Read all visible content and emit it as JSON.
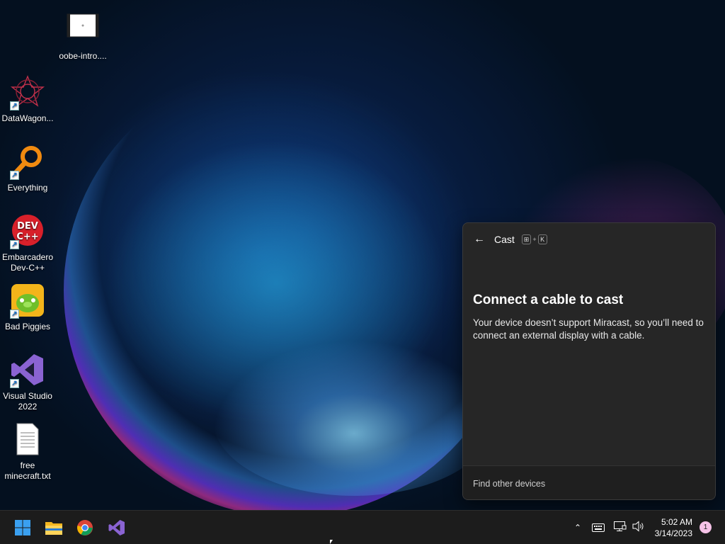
{
  "desktop": {
    "icons": [
      {
        "label": "oobe-intro....",
        "icon": "video-file-icon"
      },
      {
        "label": "DataWagon...",
        "icon": "datawagon-icon"
      },
      {
        "label": "Everything",
        "icon": "everything-search-icon"
      },
      {
        "label": "Embarcadero Dev-C++",
        "icon": "devcpp-icon"
      },
      {
        "label": "Bad Piggies",
        "icon": "bad-piggies-icon"
      },
      {
        "label": "Visual Studio 2022",
        "icon": "visual-studio-icon"
      },
      {
        "label": "free minecraft.txt",
        "icon": "text-file-icon"
      }
    ]
  },
  "cast_panel": {
    "title": "Cast",
    "shortcut_key1": "⊞",
    "shortcut_plus": "+",
    "shortcut_key2": "K",
    "heading": "Connect a cable to cast",
    "description": "Your device doesn’t support Miracast, so you’ll need to connect an external display with a cable.",
    "footer_link": "Find other devices"
  },
  "taskbar": {
    "pinned": [
      "start-icon",
      "file-explorer-icon",
      "chrome-icon",
      "visual-studio-icon"
    ],
    "time": "5:02 AM",
    "date": "3/14/2023",
    "notification_count": "1"
  }
}
